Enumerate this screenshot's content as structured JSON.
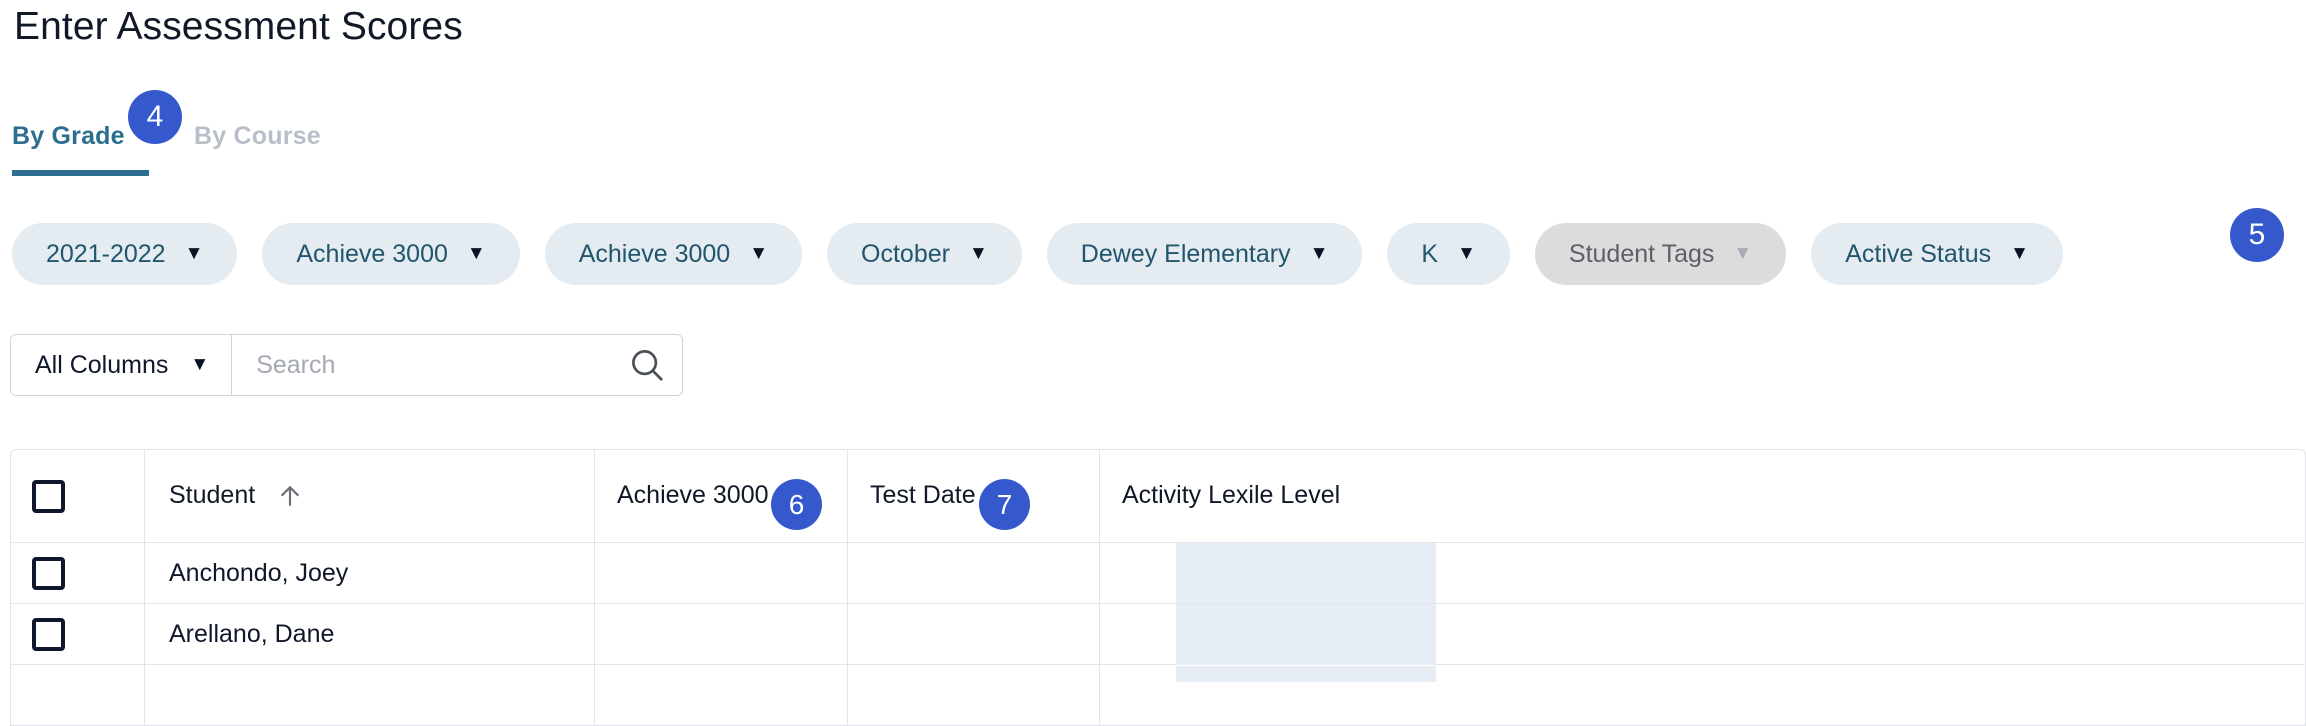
{
  "page": {
    "title": "Enter Assessment Scores"
  },
  "tabs": [
    {
      "label": "By Grade",
      "active": true,
      "badge": "4"
    },
    {
      "label": "By Course",
      "active": false,
      "badge": null
    }
  ],
  "filters": {
    "pills": [
      {
        "label": "2021-2022",
        "caret": "▼",
        "disabled": false
      },
      {
        "label": "Achieve 3000",
        "caret": "▼",
        "disabled": false
      },
      {
        "label": "Achieve 3000",
        "caret": "▼",
        "disabled": false
      },
      {
        "label": "October",
        "caret": "▼",
        "disabled": false
      },
      {
        "label": "Dewey Elementary",
        "caret": "▼",
        "disabled": false
      },
      {
        "label": "K",
        "caret": "▼",
        "disabled": false
      },
      {
        "label": "Student Tags",
        "caret": "▼",
        "disabled": true
      },
      {
        "label": "Active Status",
        "caret": "▼",
        "disabled": false
      }
    ],
    "active_status_badge": "5"
  },
  "search": {
    "column_selector_label": "All Columns",
    "column_selector_caret": "▼",
    "placeholder": "Search",
    "value": "",
    "icon": "search-icon"
  },
  "table": {
    "columns": [
      {
        "key": "select",
        "label": "",
        "badge": null,
        "sort": null
      },
      {
        "key": "student",
        "label": "Student",
        "badge": null,
        "sort": "asc"
      },
      {
        "key": "achieve",
        "label": "Achieve 3000",
        "badge": "6",
        "sort": null
      },
      {
        "key": "date",
        "label": "Test Date",
        "badge": "7",
        "sort": null
      },
      {
        "key": "lexile",
        "label": "Activity Lexile Level",
        "badge": null,
        "sort": null
      }
    ],
    "select_all_checked": false,
    "rows": [
      {
        "checked": false,
        "student": "Anchondo, Joey",
        "achieve": "",
        "date": "",
        "lexile": ""
      },
      {
        "checked": false,
        "student": "Arellano, Dane",
        "achieve": "",
        "date": "",
        "lexile": ""
      }
    ]
  },
  "colors": {
    "badge_blue": "#3559cd",
    "tab_active": "#2b6e8f",
    "tab_inactive": "#b9bfca",
    "pill_bg": "#e4ebf1",
    "pill_disabled_bg": "#dcdcdc",
    "pill_text": "#22566d",
    "highlight_cell": "#e6edf4",
    "border": "#e1e4ea"
  }
}
